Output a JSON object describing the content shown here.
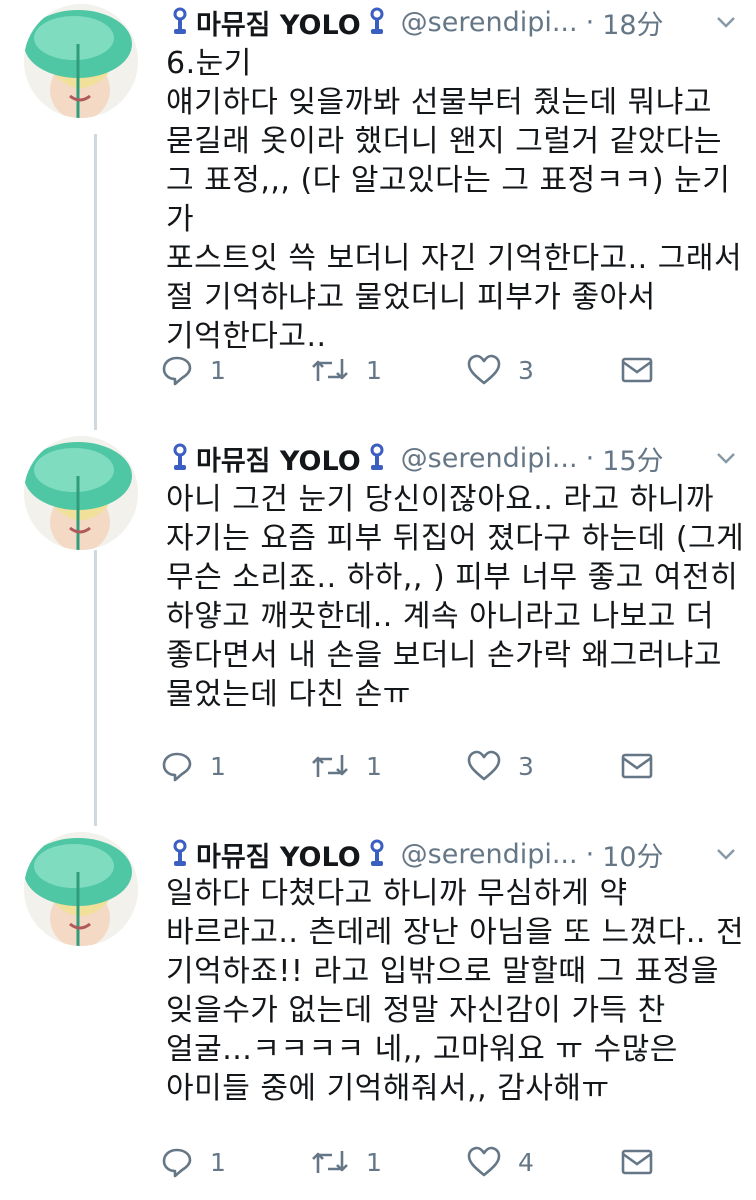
{
  "tweets": [
    {
      "display_name": "마뮤짐 YOLO",
      "handle": "@serendipi...",
      "time": "18分",
      "text": "6.눈기\n얘기하다 잊을까봐 선물부터 줬는데 뭐냐고\n묻길래 옷이라 했더니 왠지 그럴거 같았다는\n그 표정,,, (다 알고있다는 그 표정ㅋㅋ) 눈기가\n포스트잇 쓱 보더니 자긴 기억한다고.. 그래서\n절 기억하냐고 물었더니 피부가 좋아서\n기억한다고..",
      "reply_count": "1",
      "retweet_count": "1",
      "like_count": "3"
    },
    {
      "display_name": "마뮤짐 YOLO",
      "handle": "@serendipi...",
      "time": "15分",
      "text": "아니 그건 눈기 당신이잖아요.. 라고 하니까\n자기는 요즘 피부 뒤집어 졌다구 하는데 (그게\n무슨 소리죠.. 하하,, ) 피부 너무 좋고 여전히\n하얗고 깨끗한데.. 계속 아니라고 나보고 더\n좋다면서 내 손을 보더니 손가락  왜그러냐고\n물었는데 다친 손ㅠ",
      "reply_count": "1",
      "retweet_count": "1",
      "like_count": "3"
    },
    {
      "display_name": "마뮤짐 YOLO",
      "handle": "@serendipi...",
      "time": "10分",
      "text": "일하다 다쳤다고 하니까 무심하게 약\n바르라고.. 츤데레 장난 아님을 또 느꼈다.. 전\n기억하죠!! 라고 입밖으로 말할때 그 표정을\n잊을수가 없는데 정말 자신감이 가득 찬\n얼굴...ㅋㅋㅋㅋ 네,, 고마워요 ㅠ 수많은\n아미들 중에 기억해줘서,, 감사해ㅠ",
      "reply_count": "1",
      "retweet_count": "1",
      "like_count": "4"
    }
  ],
  "colors": {
    "text": "#14171a",
    "secondary": "#657786",
    "thread_line": "#cfd9de",
    "pin_blue": "#3b5fc0"
  },
  "icons": [
    "pin-icon",
    "caret-down-icon",
    "reply-icon",
    "retweet-icon",
    "heart-icon",
    "envelope-icon"
  ]
}
